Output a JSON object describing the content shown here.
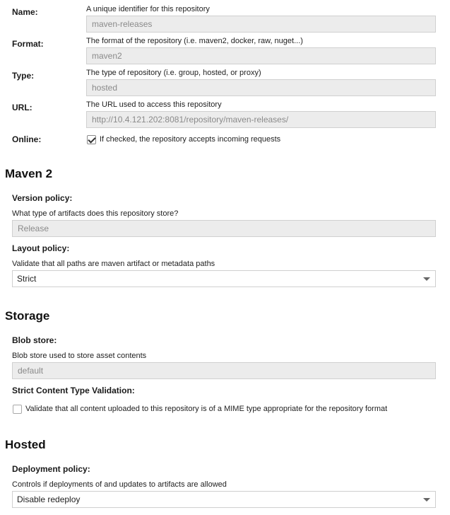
{
  "general": {
    "name": {
      "label": "Name:",
      "help": "A unique identifier for this repository",
      "value": "maven-releases"
    },
    "format": {
      "label": "Format:",
      "help": "The format of the repository (i.e. maven2, docker, raw, nuget...)",
      "value": "maven2"
    },
    "type": {
      "label": "Type:",
      "help": "The type of repository (i.e. group, hosted, or proxy)",
      "value": "hosted"
    },
    "url": {
      "label": "URL:",
      "help": "The URL used to access this repository",
      "value": "http://10.4.121.202:8081/repository/maven-releases/"
    },
    "online": {
      "label": "Online:",
      "checked": true,
      "text": "If checked, the repository accepts incoming requests"
    }
  },
  "maven2": {
    "title": "Maven 2",
    "version_policy": {
      "label": "Version policy:",
      "help": "What type of artifacts does this repository store?",
      "value": "Release"
    },
    "layout_policy": {
      "label": "Layout policy:",
      "help": "Validate that all paths are maven artifact or metadata paths",
      "value": "Strict"
    }
  },
  "storage": {
    "title": "Storage",
    "blob_store": {
      "label": "Blob store:",
      "help": "Blob store used to store asset contents",
      "value": "default"
    },
    "strict_content": {
      "label": "Strict Content Type Validation:",
      "checked": false,
      "text": "Validate that all content uploaded to this repository is of a MIME type appropriate for the repository format"
    }
  },
  "hosted": {
    "title": "Hosted",
    "deployment_policy": {
      "label": "Deployment policy:",
      "help": "Controls if deployments of and updates to artifacts are allowed",
      "value": "Disable redeploy"
    }
  }
}
